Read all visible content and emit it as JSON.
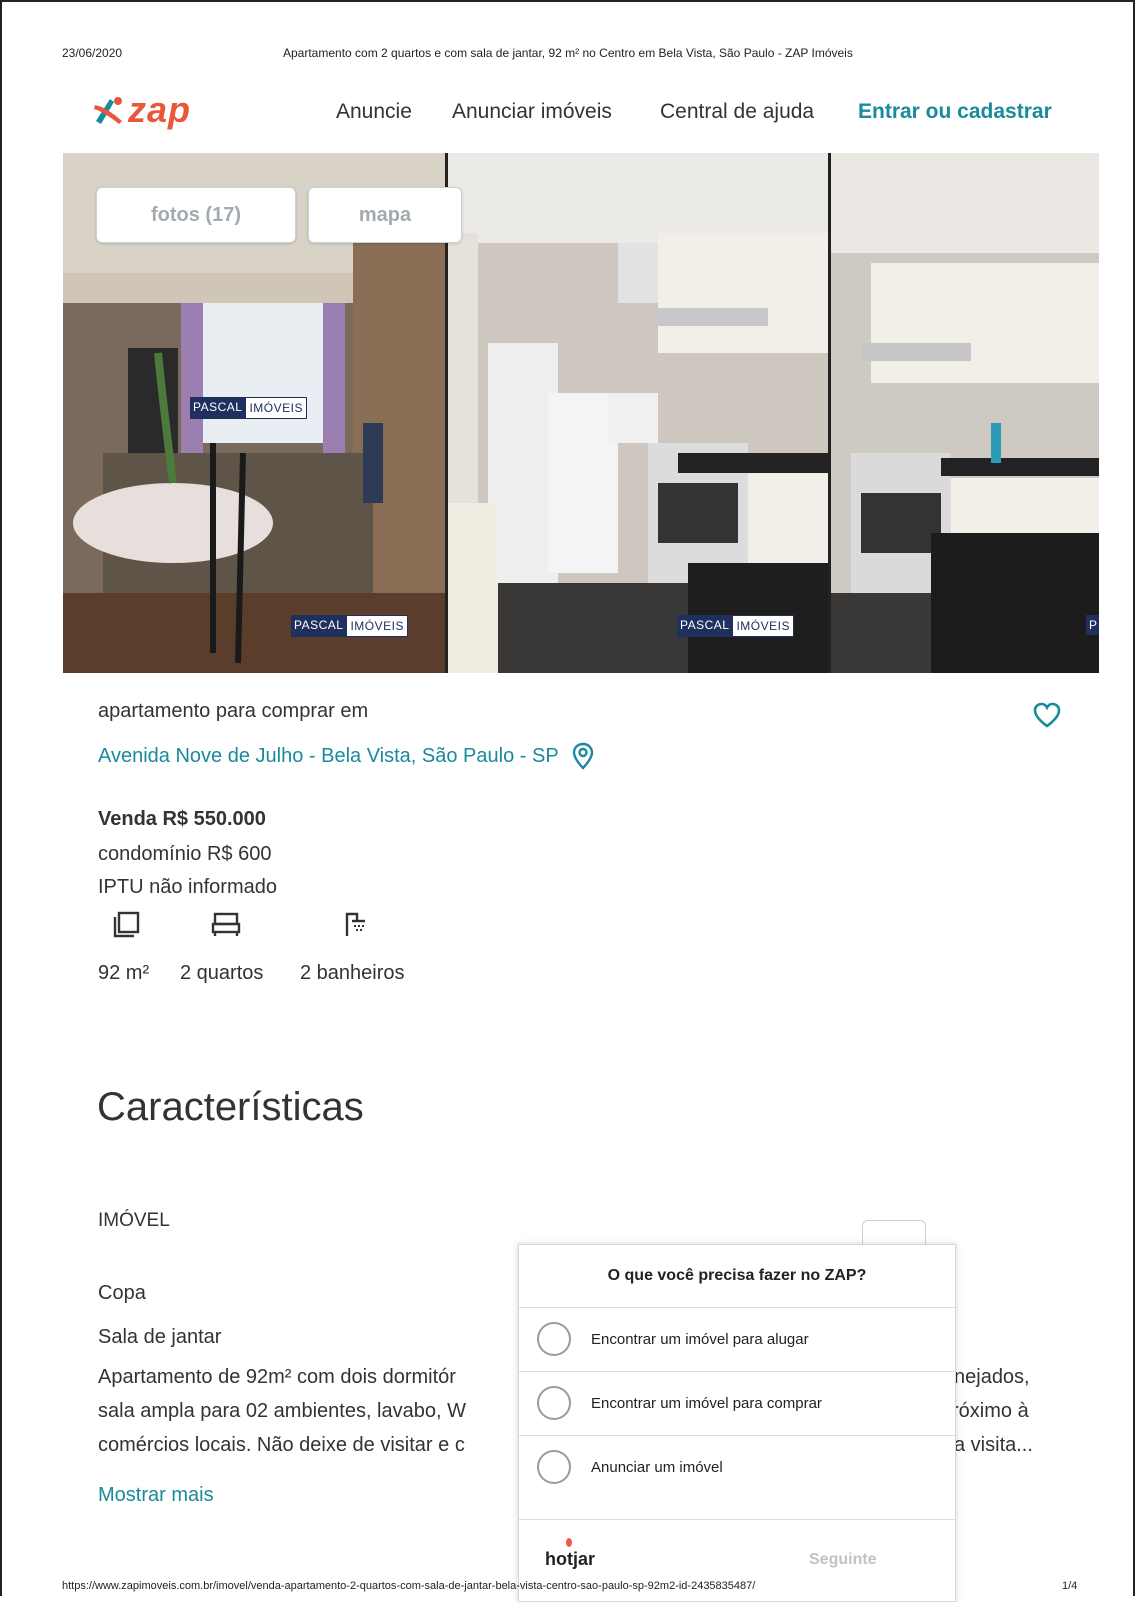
{
  "print_header": {
    "date": "23/06/2020",
    "page_title": "Apartamento com 2 quartos e com sala de jantar, 92 m² no Centro em Bela Vista, São Paulo - ZAP Imóveis"
  },
  "header": {
    "logo_text": "zap",
    "nav": [
      "Anuncie",
      "Anunciar imóveis",
      "Central de ajuda",
      "Entrar ou cadastrar"
    ]
  },
  "gallery": {
    "photos_button": "fotos (17)",
    "map_button": "mapa",
    "watermark_a": "PASCAL",
    "watermark_b": "IMÓVEIS",
    "watermark_partial": "P"
  },
  "listing": {
    "subtitle": "apartamento para comprar em",
    "address": "Avenida Nove de Julho - Bela Vista, São Paulo - SP",
    "price": "Venda R$ 550.000",
    "condo": "condomínio R$ 600",
    "iptu": "IPTU não informado",
    "area": "92 m²",
    "bedrooms": "2 quartos",
    "bathrooms": "2 banheiros"
  },
  "features": {
    "section_title": "Características",
    "group_title": "IMÓVEL",
    "items": [
      "Copa",
      "Sala de jantar"
    ],
    "description_line1_left": "Apartamento de 92m² com dois dormitór",
    "description_line1_right": "nejados,",
    "description_line2_left": "sala ampla para 02 ambientes, lavabo, W",
    "description_line2_right": "róximo à",
    "description_line3_left": "comércios locais. Não deixe de visitar e c",
    "description_line3_right": "a visita...",
    "show_more": "Mostrar mais"
  },
  "survey": {
    "question": "O que você precisa fazer no ZAP?",
    "options": [
      "Encontrar um imóvel para alugar",
      "Encontrar um imóvel para comprar",
      "Anunciar um imóvel"
    ],
    "brand": "hotjar",
    "next": "Seguinte"
  },
  "print_footer": {
    "url": "https://www.zapimoveis.com.br/imovel/venda-apartamento-2-quartos-com-sala-de-jantar-bela-vista-centro-sao-paulo-sp-92m2-id-2435835487/",
    "page": "1/4"
  },
  "colors": {
    "brand_orange": "#e8573a",
    "brand_teal": "#1a8a9c",
    "watermark_navy": "#20305e"
  }
}
